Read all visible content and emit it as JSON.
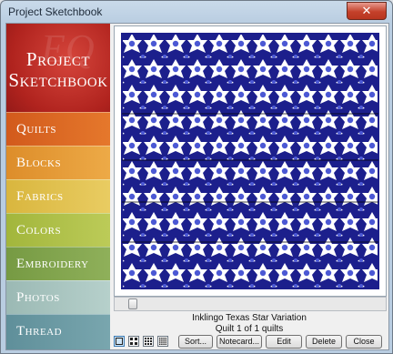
{
  "window": {
    "title": "Project Sketchbook",
    "close_glyph": "✕"
  },
  "brand": {
    "line1": "Project",
    "line2": "Sketchbook",
    "watermark": "EQ"
  },
  "nav": [
    {
      "label": "Quilts",
      "color": "#e06a25"
    },
    {
      "label": "Blocks",
      "color": "#e89a38"
    },
    {
      "label": "Fabrics",
      "color": "#e2c150"
    },
    {
      "label": "Colors",
      "color": "#b1c34b"
    },
    {
      "label": "Embroidery",
      "color": "#83a64e"
    },
    {
      "label": "Photos",
      "color": "#a9c6c1"
    },
    {
      "label": "Thread",
      "color": "#6c9aa4"
    }
  ],
  "preview": {
    "name": "Inklingo Texas Star Variation",
    "counter": "Quilt 1 of 1 quilts",
    "quilt_colors": {
      "navy": "#1c1f8c",
      "blue": "#4b58d4",
      "white": "#ffffff"
    }
  },
  "view_buttons": [
    {
      "icon": "single-view-icon"
    },
    {
      "icon": "grid-2x2-icon"
    },
    {
      "icon": "grid-3x3-icon"
    },
    {
      "icon": "grid-4x4-icon"
    }
  ],
  "buttons": {
    "sort": "Sort...",
    "notecard": "Notecard...",
    "edit": "Edit",
    "delete": "Delete",
    "close": "Close"
  }
}
